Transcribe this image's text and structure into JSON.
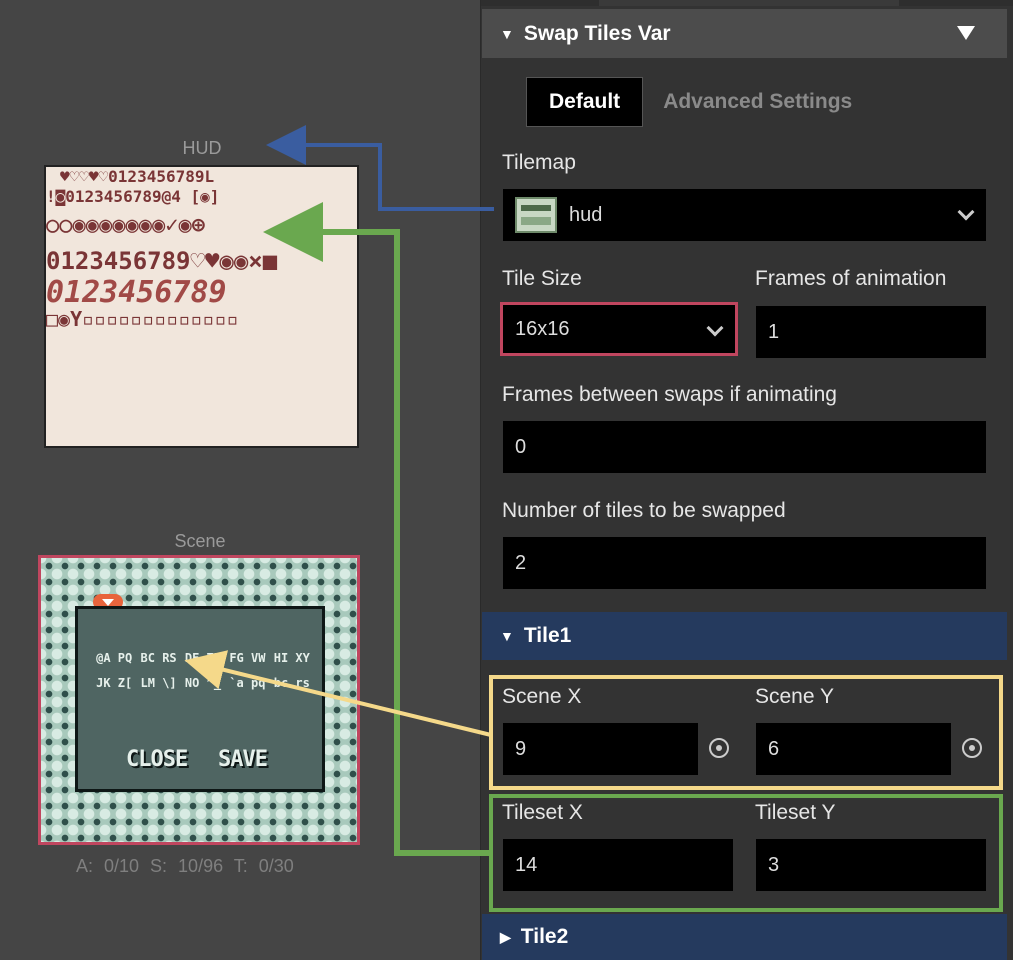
{
  "canvas": {
    "hud_label": "HUD",
    "scene_label": "Scene",
    "hud_rows": [
      "♥♡♡♥♡0123456789L",
      "!◙0123456789@4 [◉] ",
      "○○◉◉◉◉◉◉◉✓◉⊕",
      "0123456789♡♥◉◉×■",
      "0123456789",
      "□◉Y▫▫▫▫▫▫▫▫▫▫▫▫▫"
    ],
    "scene_cells": [
      "@A PQ",
      "BC RS",
      "DE TU",
      "FG VW",
      "HI XY",
      "JK Z[",
      "LM \\]",
      "NO ^_",
      "`a pq",
      "bc rs"
    ],
    "scene_close": "CLOSE",
    "scene_save": "SAVE",
    "stats": "A: 0/10   S: 10/96   T: 0/30"
  },
  "panel": {
    "section_title": "Swap Tiles Var",
    "tabs": {
      "default": "Default",
      "advanced": "Advanced Settings"
    },
    "tilemap": {
      "label": "Tilemap",
      "value": "hud"
    },
    "tile_size": {
      "label": "Tile Size",
      "value": "16x16"
    },
    "frames_anim": {
      "label": "Frames of animation",
      "value": "1"
    },
    "frames_between": {
      "label": "Frames between swaps if animating",
      "value": "0"
    },
    "num_tiles": {
      "label": "Number of tiles to be swapped",
      "value": "2"
    },
    "tile1": {
      "title": "Tile1",
      "scene_x_label": "Scene X",
      "scene_x": "9",
      "scene_y_label": "Scene Y",
      "scene_y": "6",
      "tileset_x_label": "Tileset X",
      "tileset_x": "14",
      "tileset_y_label": "Tileset Y",
      "tileset_y": "3"
    },
    "tile2": {
      "title": "Tile2"
    }
  },
  "colors": {
    "highlight_red": "#c0465f",
    "highlight_yellow": "#f5d98a",
    "highlight_green": "#6aa84f",
    "arrow_blue": "#3a5da0",
    "section_blue": "#253a5e"
  }
}
